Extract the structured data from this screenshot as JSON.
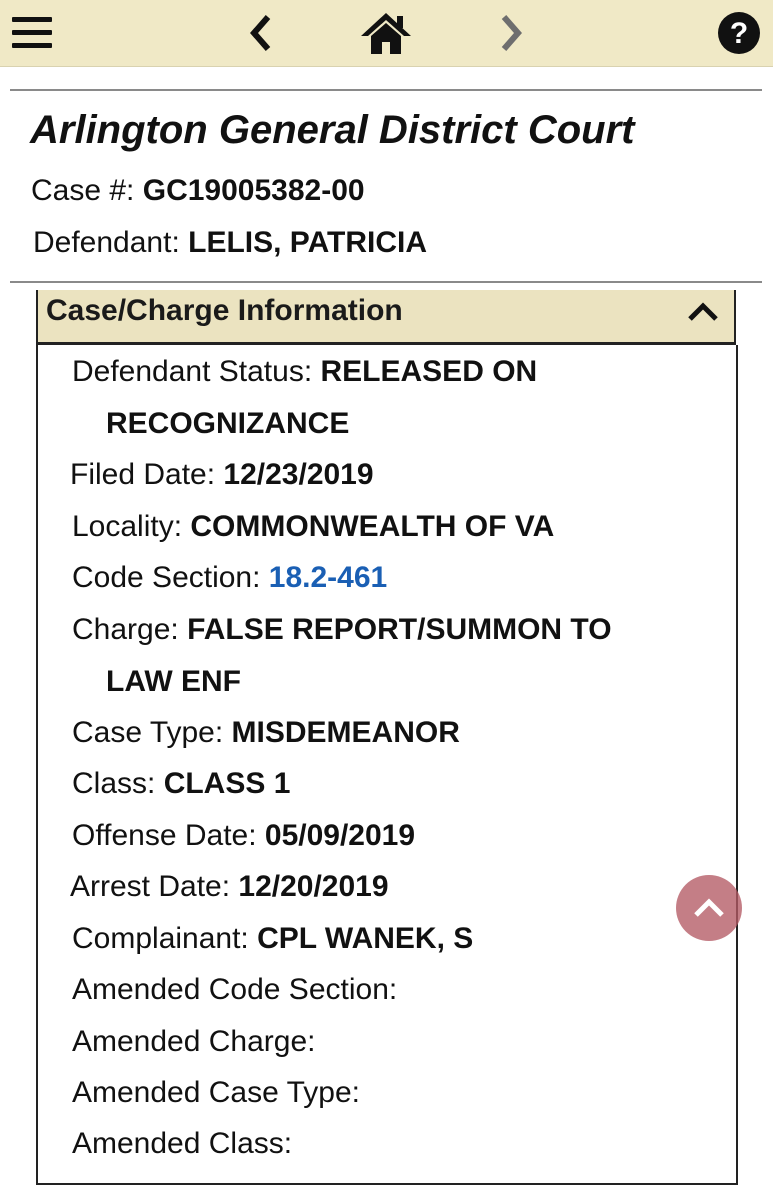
{
  "nav": {
    "menu_icon": "hamburger-menu-icon",
    "back_icon": "chevron-left-icon",
    "home_icon": "home-icon",
    "forward_icon": "chevron-right-icon",
    "help_icon": "question-circle-icon"
  },
  "header": {
    "court_name": "Arlington General District Court",
    "case_number_label": "Case #: ",
    "case_number": "GC19005382-00",
    "defendant_label": "Defendant: ",
    "defendant_name": "LELIS, PATRICIA"
  },
  "panel": {
    "title": "Case/Charge Information",
    "toggle_icon": "chevron-up-icon",
    "fields": {
      "defendant_status": {
        "label": "Defendant Status: ",
        "value": "RELEASED ON",
        "value_cont": "RECOGNIZANCE"
      },
      "filed_date": {
        "label": "Filed Date: ",
        "value": "12/23/2019"
      },
      "locality": {
        "label": "Locality: ",
        "value": "COMMONWEALTH OF VA"
      },
      "code_section": {
        "label": "Code Section: ",
        "value": "18.2-461"
      },
      "charge": {
        "label": "Charge: ",
        "value": "FALSE REPORT/SUMMON TO",
        "value_cont": "LAW ENF"
      },
      "case_type": {
        "label": "Case Type: ",
        "value": "MISDEMEANOR"
      },
      "class": {
        "label": "Class: ",
        "value": "CLASS 1"
      },
      "offense_date": {
        "label": "Offense Date: ",
        "value": "05/09/2019"
      },
      "arrest_date": {
        "label": "Arrest Date: ",
        "value": "12/20/2019"
      },
      "complainant": {
        "label": "Complainant: ",
        "value": "CPL WANEK, S"
      },
      "amended_code_section": {
        "label": "Amended Code Section:",
        "value": ""
      },
      "amended_charge": {
        "label": "Amended Charge:",
        "value": ""
      },
      "amended_case_type": {
        "label": "Amended Case Type:",
        "value": ""
      },
      "amended_class": {
        "label": "Amended Class:",
        "value": ""
      }
    }
  },
  "scroll_top": {
    "icon": "chevron-up-icon"
  },
  "colors": {
    "topbar_bg": "#f0e9c6",
    "panel_header_bg": "#ebe3c0",
    "link": "#1a5fb4",
    "scroll_button": "#b45a64"
  }
}
